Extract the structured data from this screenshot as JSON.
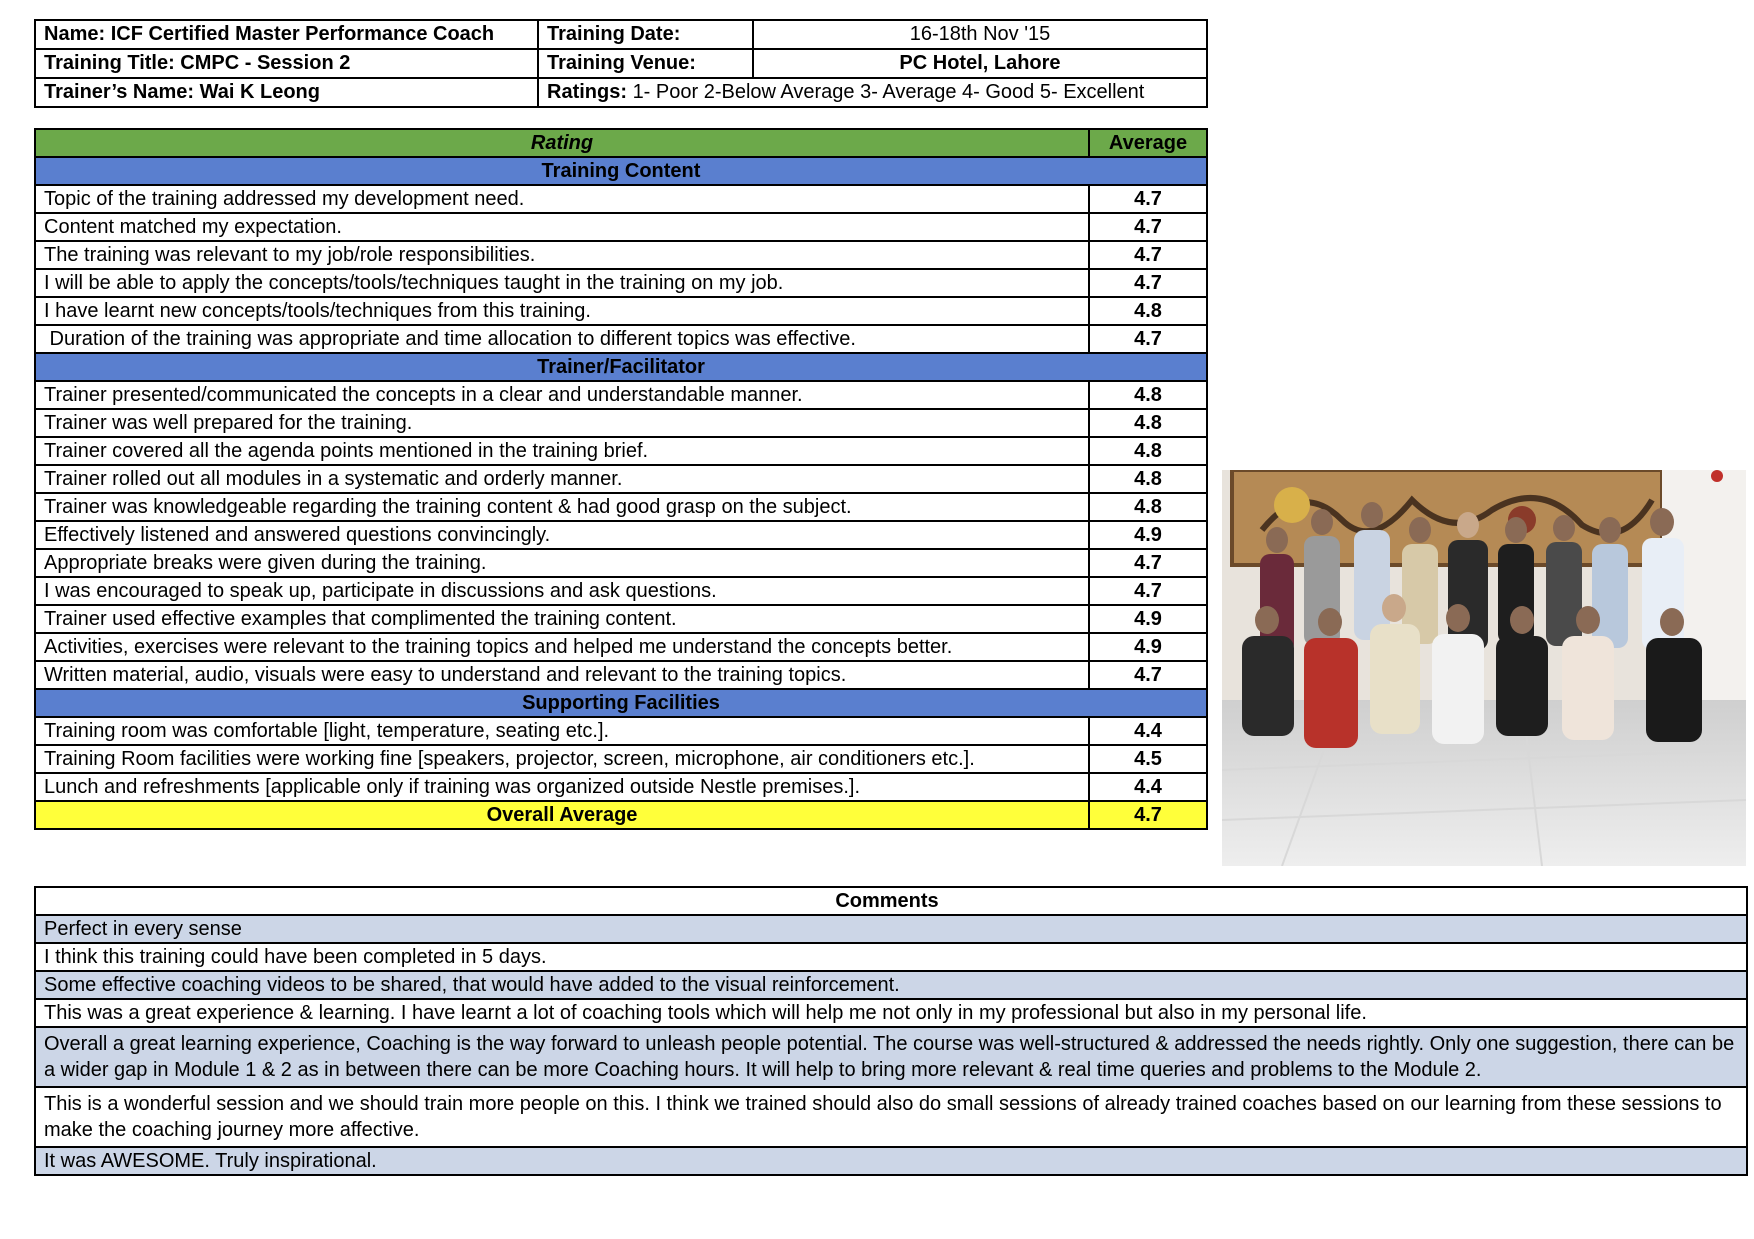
{
  "header": {
    "name": "Name: ICF Certified Master Performance Coach",
    "training_date_label": "Training Date:",
    "training_date_value": "16-18th Nov '15",
    "training_title": "Training Title: CMPC - Session 2",
    "training_venue_label": "Training Venue:",
    "training_venue_value": "PC Hotel, Lahore",
    "trainer_name": "Trainer’s Name: Wai K Leong",
    "ratings_label": "Ratings:",
    "ratings_scale": "1- Poor 2-Below Average  3- Average  4- Good  5- Excellent"
  },
  "ratings_table": {
    "col_rating": "Rating",
    "col_average": "Average",
    "sections": [
      {
        "title": "Training Content",
        "rows": [
          {
            "item": "Topic of the training addressed my development need.",
            "avg": "4.7"
          },
          {
            "item": "Content matched my expectation.",
            "avg": "4.7"
          },
          {
            "item": "The training was relevant to my job/role responsibilities.",
            "avg": "4.7"
          },
          {
            "item": "I will be able to apply the concepts/tools/techniques taught in the training on my job.",
            "avg": "4.7"
          },
          {
            "item": "I have learnt new concepts/tools/techniques from this training.",
            "avg": "4.8"
          },
          {
            "item": " Duration of the training was appropriate and time allocation to different topics was effective.",
            "avg": "4.7"
          }
        ]
      },
      {
        "title": "Trainer/Facilitator",
        "rows": [
          {
            "item": "Trainer presented/communicated the concepts in a clear and understandable manner.",
            "avg": "4.8"
          },
          {
            "item": "Trainer was well prepared for the training.",
            "avg": "4.8"
          },
          {
            "item": "Trainer covered all the agenda points mentioned in the training brief.",
            "avg": "4.8"
          },
          {
            "item": "Trainer rolled out all modules in a systematic and orderly manner.",
            "avg": "4.8"
          },
          {
            "item": "Trainer was knowledgeable regarding the training content & had good grasp on the subject.",
            "avg": "4.8"
          },
          {
            "item": "Effectively listened and answered questions convincingly.",
            "avg": "4.9"
          },
          {
            "item": "Appropriate breaks were given during the training.",
            "avg": "4.7"
          },
          {
            "item": "I was encouraged to speak up, participate in discussions and ask questions.",
            "avg": "4.7"
          },
          {
            "item": "Trainer used effective examples that complimented the training content.",
            "avg": "4.9"
          },
          {
            "item": "Activities, exercises were relevant to the training topics and helped me understand the concepts better.",
            "avg": "4.9"
          },
          {
            "item": "Written material, audio, visuals were easy to understand and relevant to the training topics.",
            "avg": "4.7"
          }
        ]
      },
      {
        "title": "Supporting Facilities",
        "rows": [
          {
            "item": "Training room was comfortable [light, temperature, seating etc.].",
            "avg": "4.4"
          },
          {
            "item": "Training Room facilities were working fine [speakers, projector, screen, microphone, air conditioners etc.].",
            "avg": "4.5"
          },
          {
            "item": "Lunch and refreshments [applicable only if training was organized outside Nestle premises.].",
            "avg": "4.4"
          }
        ]
      }
    ],
    "overall_label": "Overall Average",
    "overall_value": "4.7"
  },
  "comments": {
    "title": "Comments",
    "items": [
      "Perfect in every sense",
      "I think this training could have been completed in 5 days.",
      "Some effective coaching videos to be shared, that would have added to the visual reinforcement.",
      "This was a great experience & learning. I have learnt a lot of coaching tools which will help me not only in my professional but also in my personal life.",
      "Overall a great learning experience, Coaching is the way forward to unleash people potential. The course was well-structured & addressed the needs rightly. Only one suggestion, there can be a wider gap in Module 1 & 2 as in between there can be more Coaching hours. It will help to bring more relevant & real time queries and problems to the Module 2.",
      "This is a wonderful session and we should train more people on this. I think we trained should also do small sessions of already trained coaches based on our learning from these sessions to make the coaching journey more affective.",
      "It was AWESOME. Truly inspirational."
    ]
  },
  "colors": {
    "header_green": "#6ca94a",
    "section_blue": "#5a7fcf",
    "overall_yellow": "#ffff3a",
    "comment_shade": "#ccd6e7"
  }
}
